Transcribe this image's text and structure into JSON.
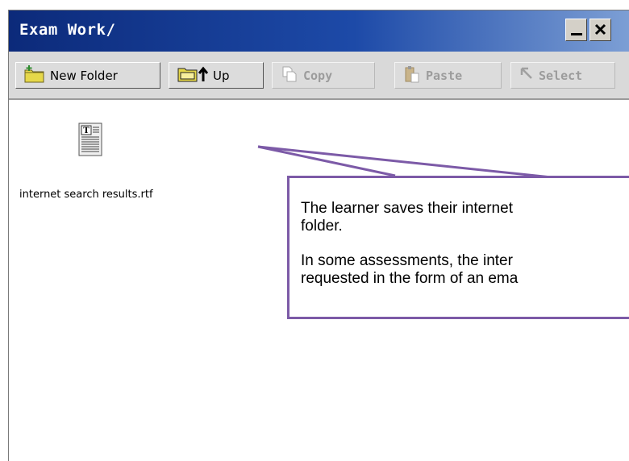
{
  "window": {
    "title": "Exam Work/"
  },
  "toolbar": {
    "new_folder": "New Folder",
    "up": "Up",
    "copy": "Copy",
    "paste": "Paste",
    "select": "Select"
  },
  "files": [
    {
      "name": "internet search results.rtf",
      "icon": "rtf-document-icon"
    }
  ],
  "callout": {
    "line1": "The learner saves their internet",
    "line2": "folder.",
    "line3": "In some assessments, the inter",
    "line4": "requested in the form of an ema"
  },
  "colors": {
    "titlebar": "#0c2a7a",
    "callout_border": "#7c5aa7",
    "toolbar_bg": "#d9d9d9"
  }
}
